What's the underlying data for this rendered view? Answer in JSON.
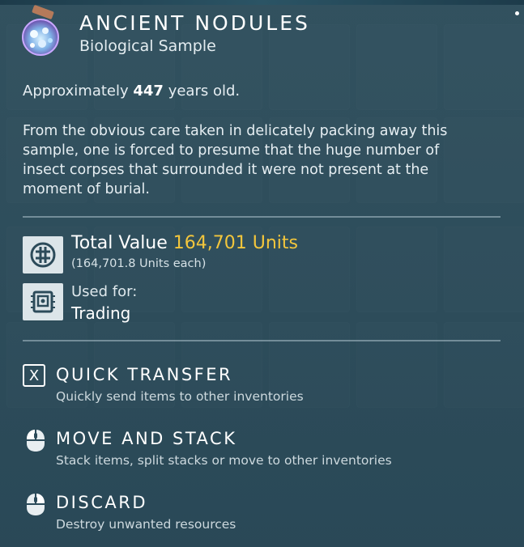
{
  "item": {
    "icon": "jar-of-nodules-icon",
    "name": "ANCIENT NODULES",
    "category": "Biological Sample",
    "age_prefix": "Approximately",
    "age_value": "447",
    "age_suffix": "years old.",
    "description": "From the obvious care taken in delicately packing away this sample, one is forced to presume that the huge number of insect corpses that surrounded it were not present at the moment of burial."
  },
  "value": {
    "icon": "units-currency-icon",
    "label": "Total Value",
    "amount": "164,701 Units",
    "each": "(164,701.8 Units each)"
  },
  "usage": {
    "icon": "trade-terminal-icon",
    "label": "Used for:",
    "value": "Trading"
  },
  "actions": [
    {
      "key": "X",
      "icon": "keyboard-x-key-icon",
      "title": "QUICK TRANSFER",
      "description": "Quickly send items to other inventories"
    },
    {
      "icon": "mouse-left-click-icon",
      "title": "MOVE AND STACK",
      "description": "Stack items, split stacks or move to other inventories"
    },
    {
      "icon": "mouse-right-click-icon",
      "title": "DISCARD",
      "description": "Destroy unwanted resources"
    }
  ],
  "colors": {
    "accent_value": "#f3c63c",
    "panel": "#345462"
  }
}
